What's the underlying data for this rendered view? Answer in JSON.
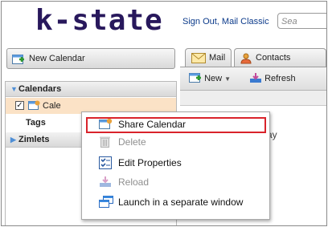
{
  "app": {
    "logo": "k-state"
  },
  "header": {
    "links": "Sign Out, Mail Classic",
    "search_placeholder": "Sea"
  },
  "sidebar": {
    "new_calendar_label": "New Calendar",
    "calendars_header": "Calendars",
    "calendar_item_label": "Cale",
    "calendar_checked": true,
    "tags_label": "Tags",
    "zimlets_label": "Zimlets"
  },
  "tabs": [
    {
      "label": "Mail",
      "icon": "mail-envelope-icon"
    },
    {
      "label": "Contacts",
      "icon": "contacts-icon"
    }
  ],
  "toolbar": {
    "new_label": "New",
    "refresh_label": "Refresh"
  },
  "calendar_view": {
    "partial_text": "ay"
  },
  "context_menu": {
    "items": [
      {
        "label": "Share Calendar",
        "icon": "share-calendar-icon",
        "enabled": true
      },
      {
        "label": "Delete",
        "icon": "trash-icon",
        "enabled": false
      },
      {
        "label": "Edit Properties",
        "icon": "edit-properties-icon",
        "enabled": true
      },
      {
        "label": "Reload",
        "icon": "reload-icon",
        "enabled": false
      },
      {
        "label": "Launch in a separate window",
        "icon": "launch-window-icon",
        "enabled": true
      }
    ]
  },
  "colors": {
    "logo": "#28185c",
    "selected_row": "#fbe2c6",
    "highlight_box": "#d9232b",
    "tree_triangle": "#4f8fd6"
  }
}
